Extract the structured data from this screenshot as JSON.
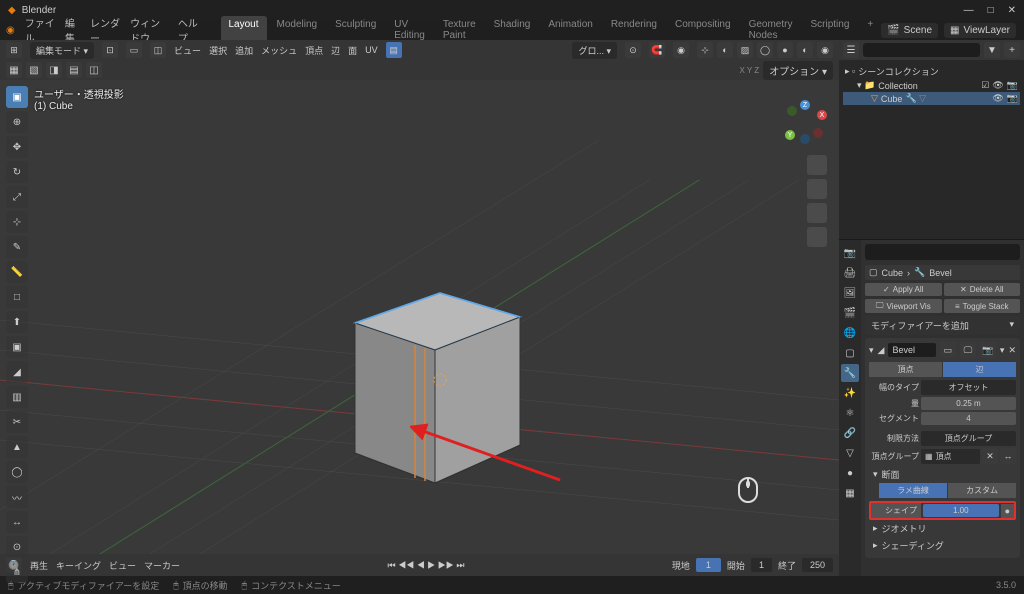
{
  "titlebar": {
    "app": "Blender",
    "min": "—",
    "max": "□",
    "close": "✕"
  },
  "menu": {
    "items": [
      "ファイル",
      "編集",
      "レンダー",
      "ウィンドウ",
      "ヘルプ"
    ],
    "workspaces": [
      "Layout",
      "Modeling",
      "Sculpting",
      "UV Editing",
      "Texture Paint",
      "Shading",
      "Animation",
      "Rendering",
      "Compositing",
      "Geometry Nodes",
      "Scripting",
      "+"
    ],
    "active_workspace": 0,
    "scene": "Scene",
    "viewlayer": "ViewLayer"
  },
  "viewport_header": {
    "mode": "編集モード",
    "items": [
      "ビュー",
      "選択",
      "追加",
      "メッシュ",
      "頂点",
      "辺",
      "面",
      "UV"
    ],
    "overlay_label": "グロ...",
    "options": "オプション"
  },
  "viewport": {
    "label_line1": "ユーザー・透視投影",
    "label_line2": "(1) Cube"
  },
  "outliner": {
    "title": "シーンコレクション",
    "collection": "Collection",
    "object": "Cube"
  },
  "properties": {
    "breadcrumb_obj": "Cube",
    "breadcrumb_mod": "Bevel",
    "apply_all": "Apply All",
    "delete_all": "Delete All",
    "viewport_vis": "Viewport Vis",
    "toggle_stack": "Toggle Stack",
    "add_modifier": "モディファイアーを追加",
    "mod_name": "Bevel",
    "vertex_label": "頂点",
    "edge_label": "辺",
    "width_type_label": "幅のタイプ",
    "width_type_value": "オフセット",
    "amount_label": "量",
    "amount_value": "0.25 m",
    "segments_label": "セグメント",
    "segments_value": "4",
    "limit_label": "制限方法",
    "limit_value": "頂点グループ",
    "vgroup_label": "頂点グループ",
    "vgroup_value": "頂点",
    "section_profile": "断面",
    "profile_super": "ラメ曲線",
    "profile_custom": "カスタム",
    "shape_label": "シェイプ",
    "shape_value": "1.00",
    "section_geometry": "ジオメトリ",
    "section_shading": "シェーディング"
  },
  "timeline": {
    "items": [
      "再生",
      "キーイング",
      "ビュー",
      "マーカー"
    ],
    "current": "現地",
    "current_frame": "1",
    "start_label": "開始",
    "start": "1",
    "end_label": "終了",
    "end": "250"
  },
  "statusbar": {
    "item1": "アクティブモディファイアーを設定",
    "item2": "頂点の移動",
    "item3": "コンテクストメニュー",
    "version": "3.5.0"
  }
}
